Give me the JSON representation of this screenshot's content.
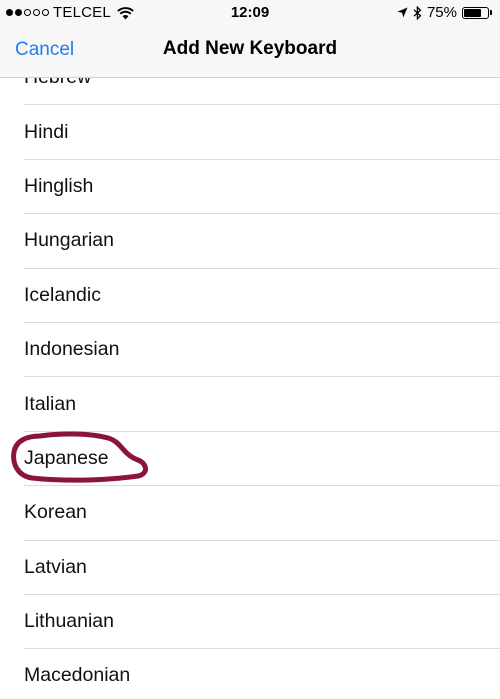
{
  "status_bar": {
    "signal_dots_filled": 2,
    "signal_dots_total": 5,
    "carrier": "TELCEL",
    "time": "12:09",
    "battery_percent": "75%",
    "battery_level": 0.75,
    "icons": [
      "wifi-icon",
      "location-arrow-icon",
      "bluetooth-icon",
      "battery-icon"
    ]
  },
  "nav": {
    "cancel_label": "Cancel",
    "title": "Add New Keyboard"
  },
  "list": {
    "items": [
      "Hebrew",
      "Hindi",
      "Hinglish",
      "Hungarian",
      "Icelandic",
      "Indonesian",
      "Italian",
      "Japanese",
      "Korean",
      "Latvian",
      "Lithuanian",
      "Macedonian"
    ]
  },
  "annotation": {
    "type": "hand-drawn circle",
    "target": "Japanese",
    "color": "#8a1538"
  },
  "colors": {
    "accent": "#1f7ef5",
    "bar_background": "#f7f7f7",
    "separator": "#dcdce0"
  }
}
